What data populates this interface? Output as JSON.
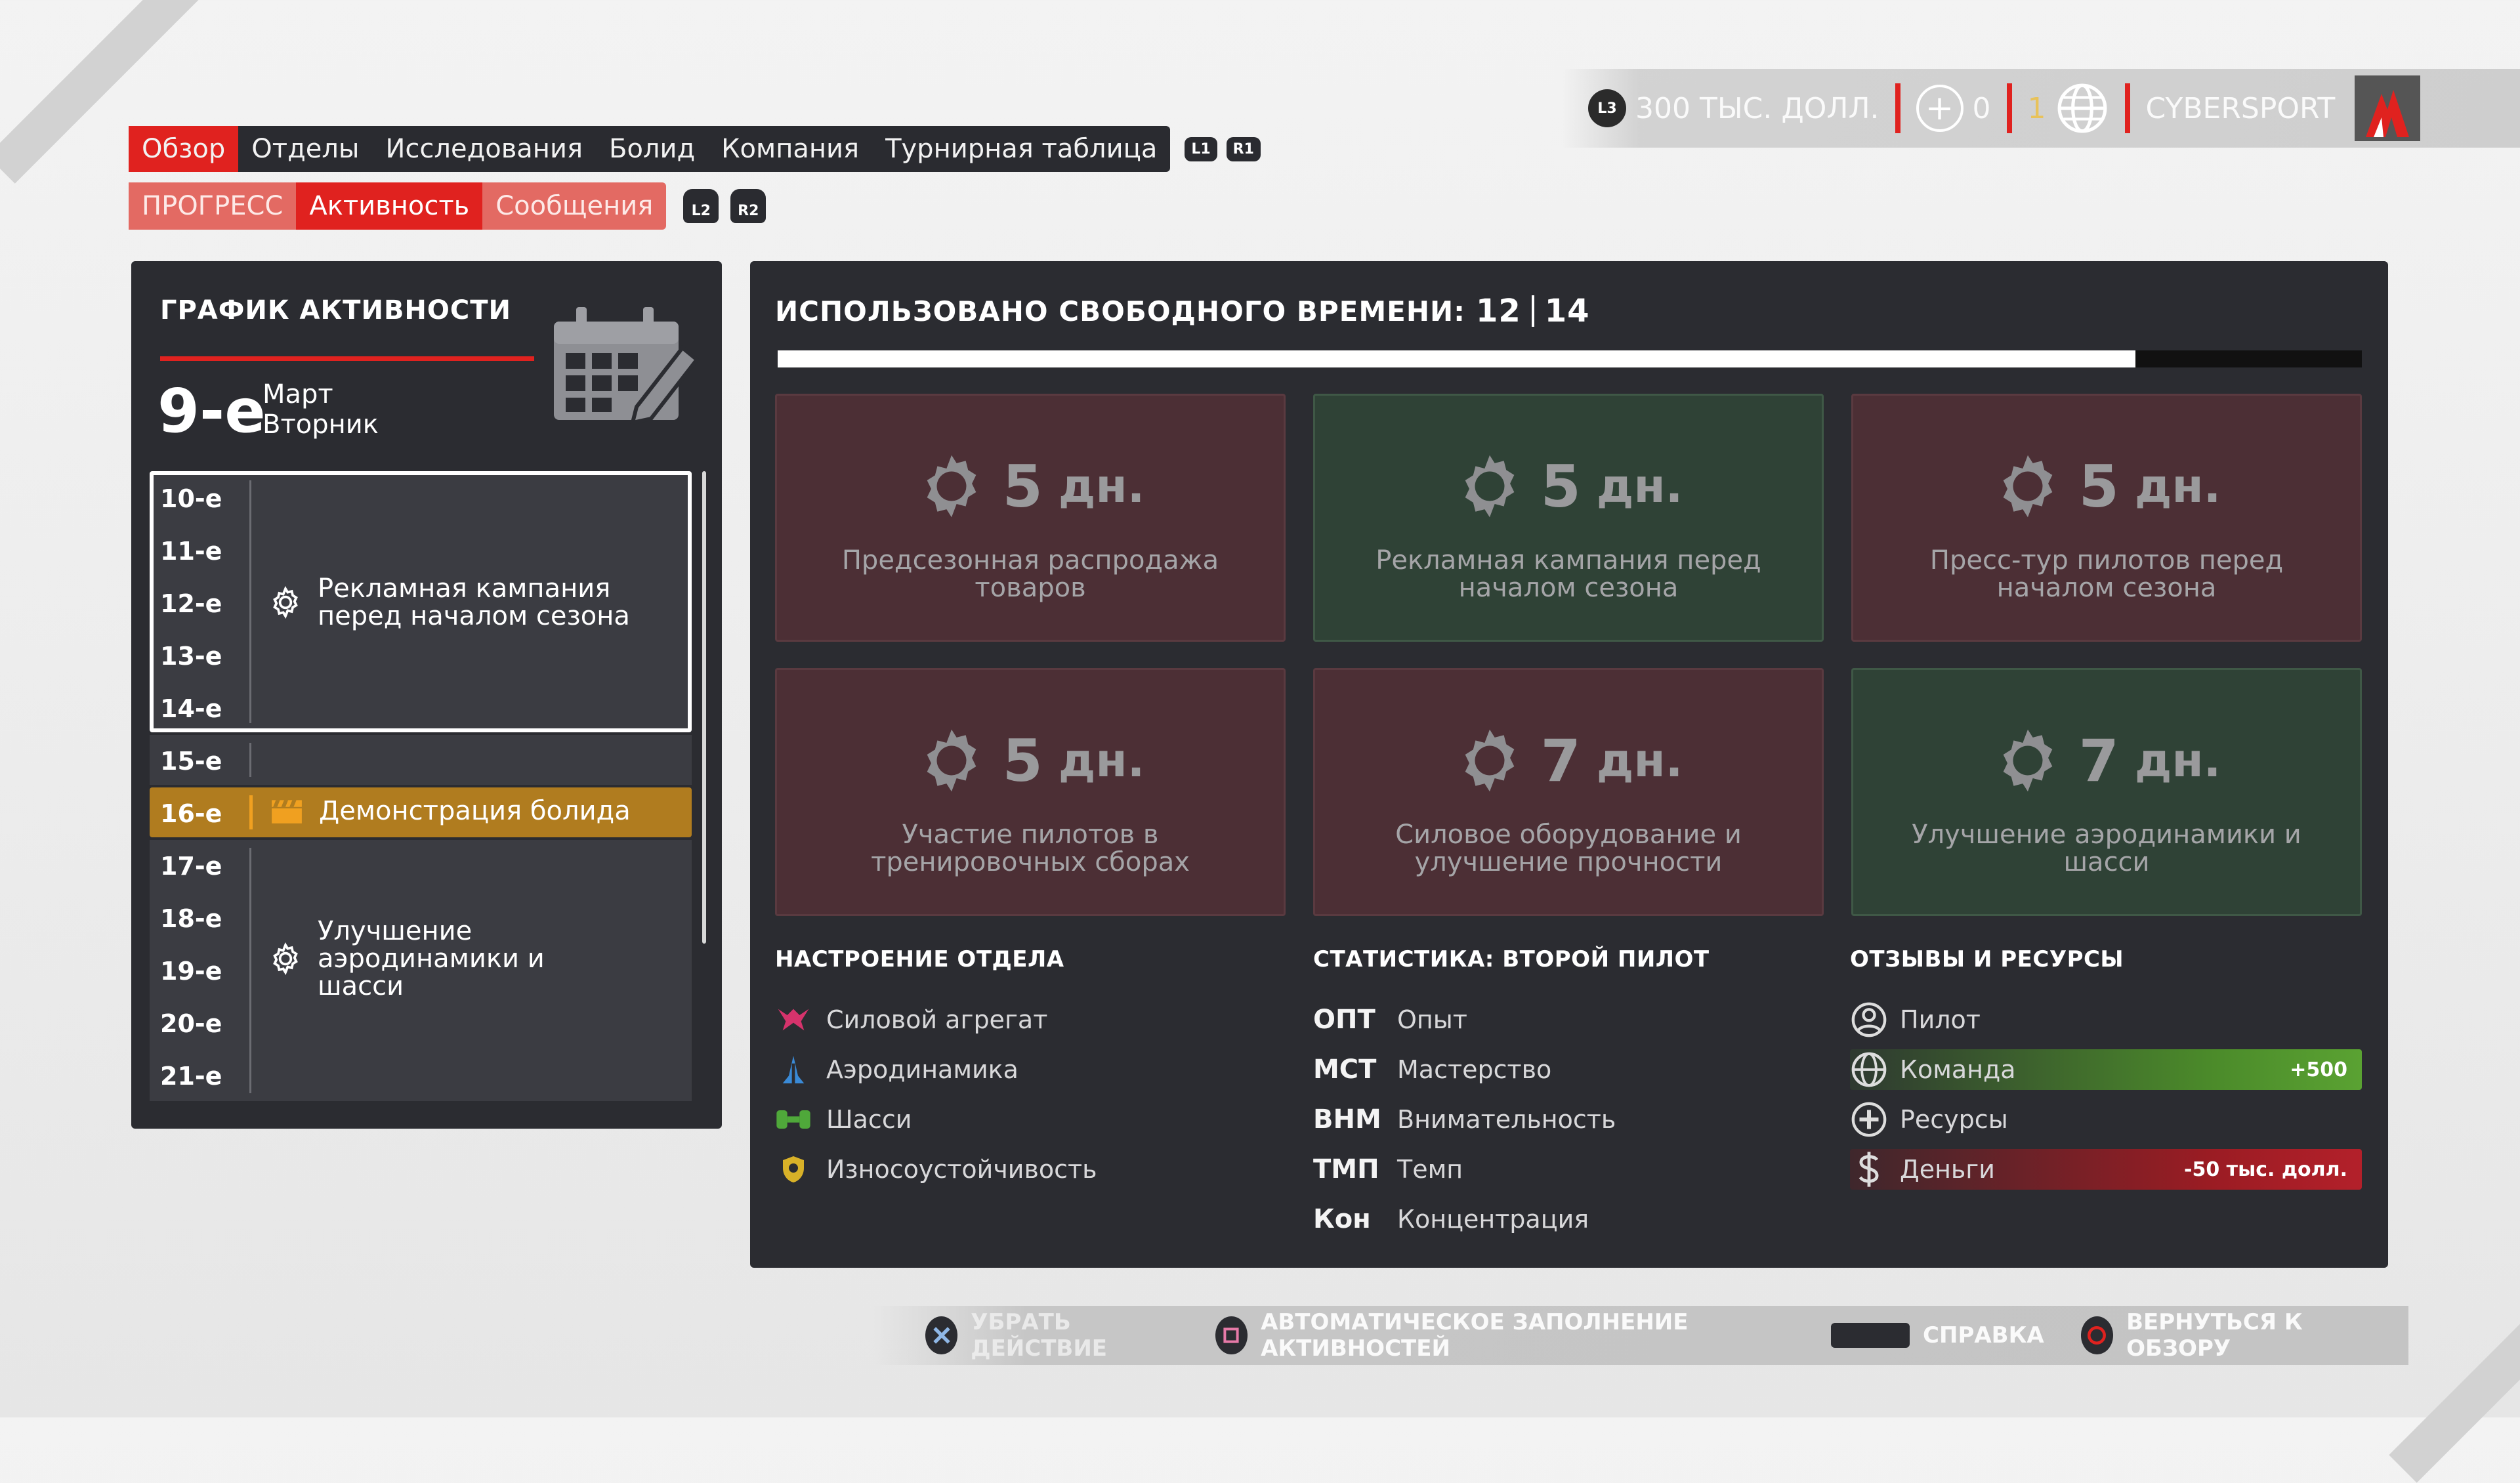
{
  "status": {
    "money": "300 ТЫС. ДОЛЛ.",
    "resources": "0",
    "team_rank": "1",
    "team_name": "CYBERSPORT",
    "l3_label": "L3"
  },
  "nav": {
    "tabs": [
      "Обзор",
      "Отделы",
      "Исследования",
      "Болид",
      "Компания",
      "Турнирная таблица"
    ],
    "l1": "L1",
    "r1": "R1"
  },
  "subnav": {
    "tabs": [
      "ПРОГРЕСС",
      "Активность",
      "Сообщения"
    ],
    "l2": "L2",
    "r2": "R2"
  },
  "schedule": {
    "title": "ГРАФИК АКТИВНОСТИ",
    "current_day": "9-е",
    "month": "Март",
    "weekday": "Вторник",
    "days": [
      "10-е",
      "11-е",
      "12-е",
      "13-е",
      "14-е",
      "15-е",
      "16-е",
      "17-е",
      "18-е",
      "19-е",
      "20-е",
      "21-е"
    ],
    "events": [
      {
        "label": "Рекламная кампания перед началом сезона"
      },
      {
        "label": "Демонстрация болида"
      },
      {
        "label": "Улучшение аэродинамики и шасси"
      }
    ]
  },
  "time": {
    "label": "ИСПОЛЬЗОВАНО СВОБОДНОГО ВРЕМЕНИ:",
    "used": "12",
    "total": "14",
    "progress": 0.857
  },
  "activities": [
    {
      "days": "5",
      "unit": "дн.",
      "label": "Предсезонная распродажа товаров",
      "state": "red"
    },
    {
      "days": "5",
      "unit": "дн.",
      "label": "Рекламная кампания перед началом сезона",
      "state": "green"
    },
    {
      "days": "5",
      "unit": "дн.",
      "label": "Пресс-тур пилотов перед началом сезона",
      "state": "red"
    },
    {
      "days": "5",
      "unit": "дн.",
      "label": "Участие пилотов в тренировочных сборах",
      "state": "red"
    },
    {
      "days": "7",
      "unit": "дн.",
      "label": "Силовое оборудование и улучшение прочности",
      "state": "red"
    },
    {
      "days": "7",
      "unit": "дн.",
      "label": "Улучшение аэродинамики и шасси",
      "state": "green"
    }
  ],
  "mood": {
    "title": "НАСТРОЕНИЕ ОТДЕЛА",
    "items": [
      "Силовой агрегат",
      "Аэродинамика",
      "Шасси",
      "Износоустойчивость"
    ]
  },
  "stats": {
    "title": "СТАТИСТИКА: ВТОРОЙ ПИЛОТ",
    "items": [
      {
        "abbr": "ОПТ",
        "name": "Опыт"
      },
      {
        "abbr": "МСТ",
        "name": "Мастерство"
      },
      {
        "abbr": "ВНМ",
        "name": "Внимательность"
      },
      {
        "abbr": "ТМП",
        "name": "Темп"
      },
      {
        "abbr": "Кон",
        "name": "Концентрация"
      }
    ]
  },
  "feedback": {
    "title": "ОТЗЫВЫ И РЕСУРСЫ",
    "items": [
      {
        "name": "Пилот",
        "delta": ""
      },
      {
        "name": "Команда",
        "delta": "+500"
      },
      {
        "name": "Ресурсы",
        "delta": ""
      },
      {
        "name": "Деньги",
        "delta": "-50 тыс. долл."
      }
    ]
  },
  "hints": {
    "remove": "УБРАТЬ ДЕЙСТВИЕ",
    "autofill": "АВТОМАТИЧЕСКОЕ ЗАПОЛНЕНИЕ АКТИВНОСТЕЙ",
    "help": "СПРАВКА",
    "back": "ВЕРНУТЬСЯ К ОБЗОРУ"
  },
  "colors": {
    "accent": "#e0221f",
    "panel": "#2b2c31",
    "card_red": "#4c2f35",
    "card_green": "#2f4236",
    "event_highlight": "#b07c1f"
  }
}
